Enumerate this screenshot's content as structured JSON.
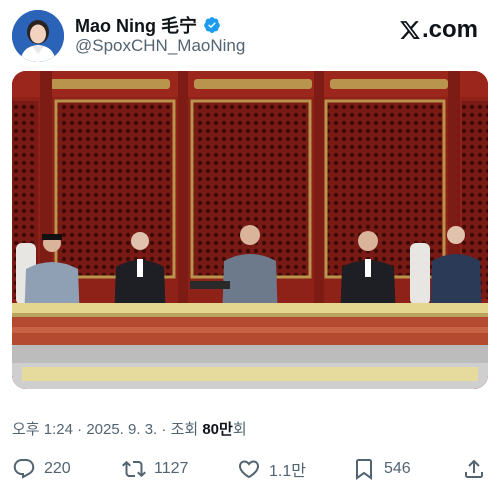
{
  "author": {
    "display_name": "Mao Ning 毛宁",
    "handle": "@SpoxCHN_MaoNing",
    "verified": true
  },
  "source_logo": {
    "text": ".com",
    "icon": "x-logo-icon"
  },
  "post": {
    "image_alt": "Five leaders standing on a balcony clapping in front of a red lattice wall",
    "meta": {
      "time": "오후 1:24",
      "sep1": " · ",
      "date": "2025. 9. 3.",
      "sep2": " · ",
      "views_label_prefix": "조회 ",
      "views_count": "80만",
      "views_label_suffix": "회"
    }
  },
  "actions": {
    "replies": "220",
    "reposts": "1127",
    "likes": "1.1만",
    "bookmarks": "546"
  },
  "colors": {
    "text_primary": "#0f1419",
    "text_secondary": "#536471",
    "verified_blue": "#1d9bf0"
  }
}
